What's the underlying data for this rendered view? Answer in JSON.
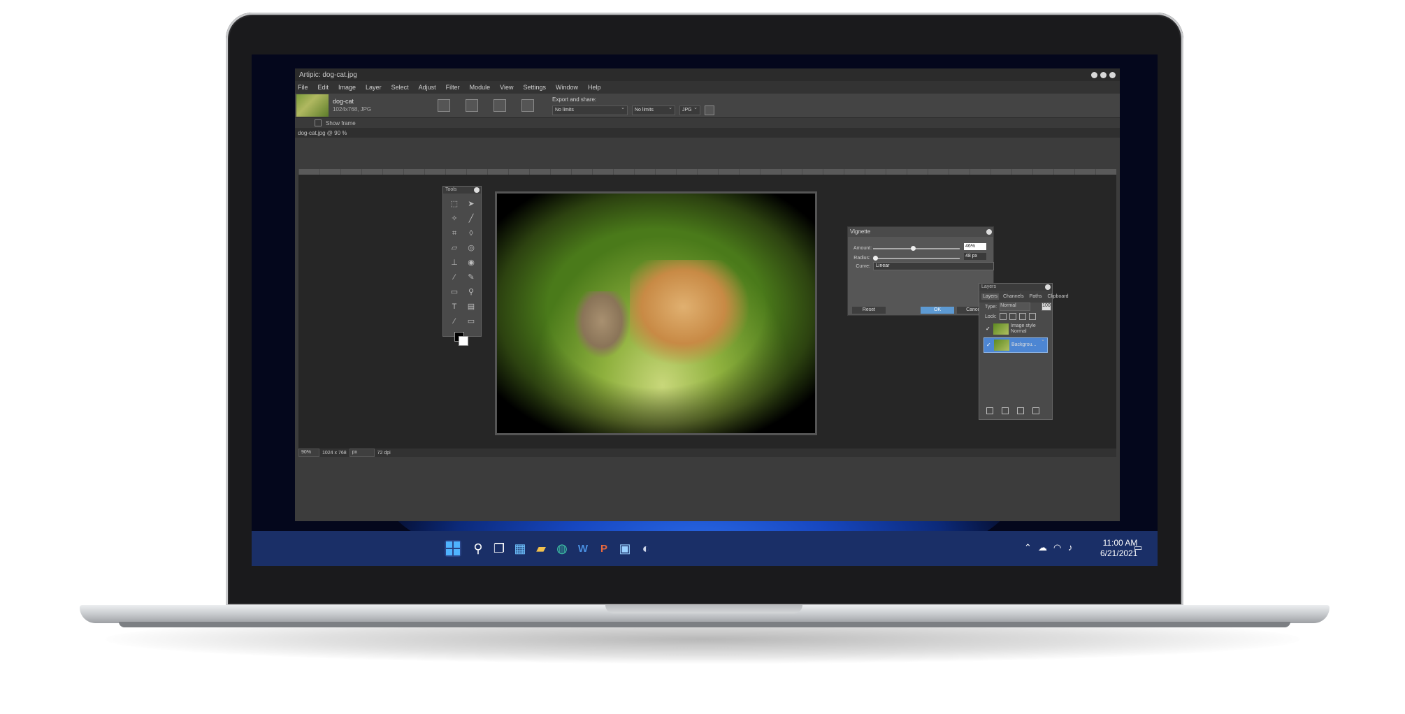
{
  "app": {
    "title": "Artipic: dog-cat.jpg",
    "menu": [
      "File",
      "Edit",
      "Image",
      "Layer",
      "Select",
      "Adjust",
      "Filter",
      "Module",
      "View",
      "Settings",
      "Window",
      "Help"
    ],
    "file": {
      "name": "dog-cat",
      "details": "1024x768, JPG"
    },
    "export": {
      "label": "Export and share:",
      "limit1": "No limits",
      "limit2": "No limits",
      "format": "JPG"
    },
    "show_frame": "Show frame",
    "document_title": "dog-cat.jpg @ 90 %",
    "status": {
      "zoom": "90%",
      "size": "1024 x 768",
      "unit": "px",
      "dpi": "72 dpi"
    }
  },
  "tools_panel": {
    "title": "Tools"
  },
  "vignette": {
    "title": "Vignette",
    "amount_label": "Amount:",
    "amount_value": "46%",
    "amount_level": 0.46,
    "radius_label": "Radius:",
    "radius_value": "48 px",
    "radius_level": 0.0,
    "curve_label": "Curve:",
    "curve_value": "Linear",
    "reset": "Reset",
    "ok": "OK",
    "cancel": "Cancel"
  },
  "layers_panel": {
    "title": "Layers",
    "tabs": [
      "Layers",
      "Channels",
      "Paths",
      "Clipboard"
    ],
    "type_label": "Type:",
    "type_value": "Normal",
    "opacity_value": "100",
    "lock_label": "Lock:",
    "layers": [
      {
        "name": "Image style",
        "sub": "Normal",
        "visible": true,
        "selected": false
      },
      {
        "name": "Backgrou...",
        "sub": "",
        "visible": true,
        "selected": true
      }
    ]
  },
  "taskbar": {
    "clock_time": "11:00 AM",
    "clock_date": "6/21/2021",
    "icons": [
      "windows-start-icon",
      "search-icon",
      "task-view-icon",
      "widgets-icon",
      "file-explorer-icon",
      "edge-icon",
      "word-icon",
      "powerpoint-icon",
      "store-icon",
      "steam-icon"
    ],
    "colors": {
      "taskbar": "#1a2f67",
      "accent": "#4fb3ff",
      "selection": "#4d86d3",
      "ok_button": "#5d9ad3"
    }
  }
}
